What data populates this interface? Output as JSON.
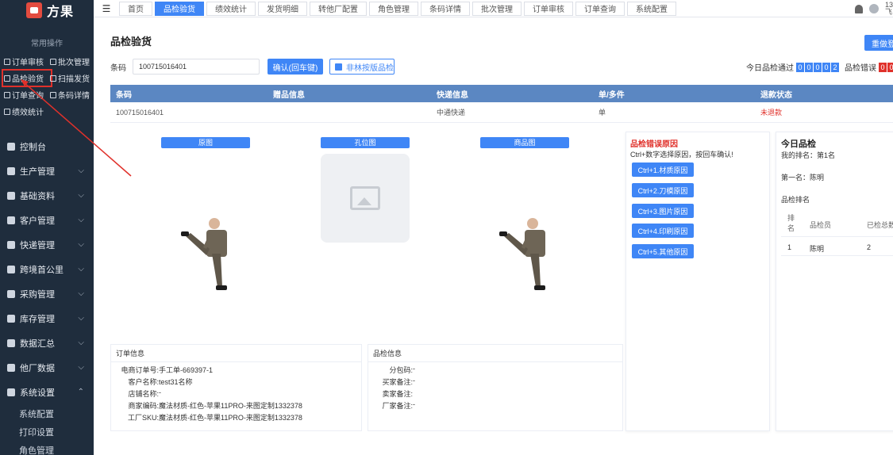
{
  "app": {
    "name": "方果"
  },
  "sidebar": {
    "quick_title": "常用操作",
    "quick_items": [
      {
        "label": "订单审核",
        "icon": "check-square-icon"
      },
      {
        "label": "批次管理",
        "icon": "layers-icon"
      },
      {
        "label": "品检验货",
        "icon": "inspect-icon"
      },
      {
        "label": "扫描发货",
        "icon": "scan-icon"
      },
      {
        "label": "订单查询",
        "icon": "search-doc-icon"
      },
      {
        "label": "条码详情",
        "icon": "barcode-icon"
      },
      {
        "label": "绩效统计",
        "icon": "chart-icon"
      }
    ],
    "menu": [
      {
        "label": "控制台",
        "icon": "dashboard-icon",
        "chevron": ""
      },
      {
        "label": "生产管理",
        "icon": "factory-icon",
        "chevron": "⌵"
      },
      {
        "label": "基础资料",
        "icon": "database-icon",
        "chevron": "⌵"
      },
      {
        "label": "客户管理",
        "icon": "user-icon",
        "chevron": "⌵"
      },
      {
        "label": "快递管理",
        "icon": "truck-icon",
        "chevron": "⌵"
      },
      {
        "label": "跨境首公里",
        "icon": "globe-icon",
        "chevron": "⌵"
      },
      {
        "label": "采购管理",
        "icon": "cart-icon",
        "chevron": "⌵"
      },
      {
        "label": "库存管理",
        "icon": "warehouse-icon",
        "chevron": "⌵"
      },
      {
        "label": "数据汇总",
        "icon": "pie-chart-icon",
        "chevron": "⌵"
      },
      {
        "label": "他厂数据",
        "icon": "pie-chart-icon",
        "chevron": "⌵"
      },
      {
        "label": "系统设置",
        "icon": "settings-icon",
        "chevron": "⌃"
      }
    ],
    "submenu": [
      "系统配置",
      "打印设置",
      "角色管理"
    ]
  },
  "topbar": {
    "tabs": [
      "首页",
      "品检验货",
      "绩效统计",
      "发货明细",
      "转他厂配置",
      "角色管理",
      "条码详情",
      "批次管理",
      "订单审核",
      "订单查询",
      "系统配置"
    ],
    "active_tab": "品检验货",
    "user_text": "13 飞"
  },
  "page": {
    "title": "品检验货",
    "redo_label": "重做登",
    "barcode_label": "条码",
    "barcode_value": "100715016401",
    "confirm_label": "确认(回车键)",
    "non_forest_label": "非林按版品检",
    "stats_pass_label": "今日品检通过",
    "stats_pass_digits": [
      "0",
      "0",
      "0",
      "0",
      "2"
    ],
    "stats_error_label": "品检错误",
    "stats_error_digits": [
      "0",
      "0"
    ]
  },
  "table": {
    "headers": [
      "条码",
      "赠品信息",
      "快递信息",
      "单/多件",
      "退款状态"
    ],
    "rows": [
      [
        "100715016401",
        "",
        "中通快递",
        "单",
        "未退款"
      ]
    ]
  },
  "images": {
    "labels": [
      "原图",
      "孔位图",
      "商品图"
    ]
  },
  "order_info": {
    "title": "订单信息",
    "rows": [
      {
        "k": "电商订单号:",
        "v": "手工单-669397-1"
      },
      {
        "k": "客户名称:",
        "v": "test31名称"
      },
      {
        "k": "店铺名称:",
        "v": "-"
      },
      {
        "k": "商家编码:",
        "v": "魔法材质-红色-苹果11PRO-来图定制1332378"
      },
      {
        "k": "工厂SKU:",
        "v": "魔法材质-红色-苹果11PRO-来图定制1332378"
      }
    ]
  },
  "qc_info": {
    "title": "品检信息",
    "rows": [
      {
        "k": "分包码:",
        "v": "-"
      },
      {
        "k": "买家备注:",
        "v": "-"
      },
      {
        "k": "卖家备注:",
        "v": ""
      },
      {
        "k": "厂家备注:",
        "v": "-"
      }
    ]
  },
  "reasons": {
    "title": "品检错误原因",
    "subtitle": "Ctrl+数字选择原因，按回车确认!",
    "buttons": [
      "Ctrl+1.材质原因",
      "Ctrl+2.刀模原因",
      "Ctrl+3.图片原因",
      "Ctrl+4.印刷原因",
      "Ctrl+5.其他原因"
    ]
  },
  "today": {
    "title": "今日品检",
    "my_rank": "我的排名：第1名",
    "first": "第一名：陈明",
    "rank_title": "品检排名",
    "headers": [
      "排名",
      "品检员",
      "已检总数"
    ],
    "rows": [
      [
        "1",
        "陈明",
        "2"
      ]
    ]
  },
  "colors": {
    "accent": "#3f86f6",
    "sidebar": "#1f2d3d",
    "danger": "#e0312b",
    "table_header": "#5b87c2"
  }
}
